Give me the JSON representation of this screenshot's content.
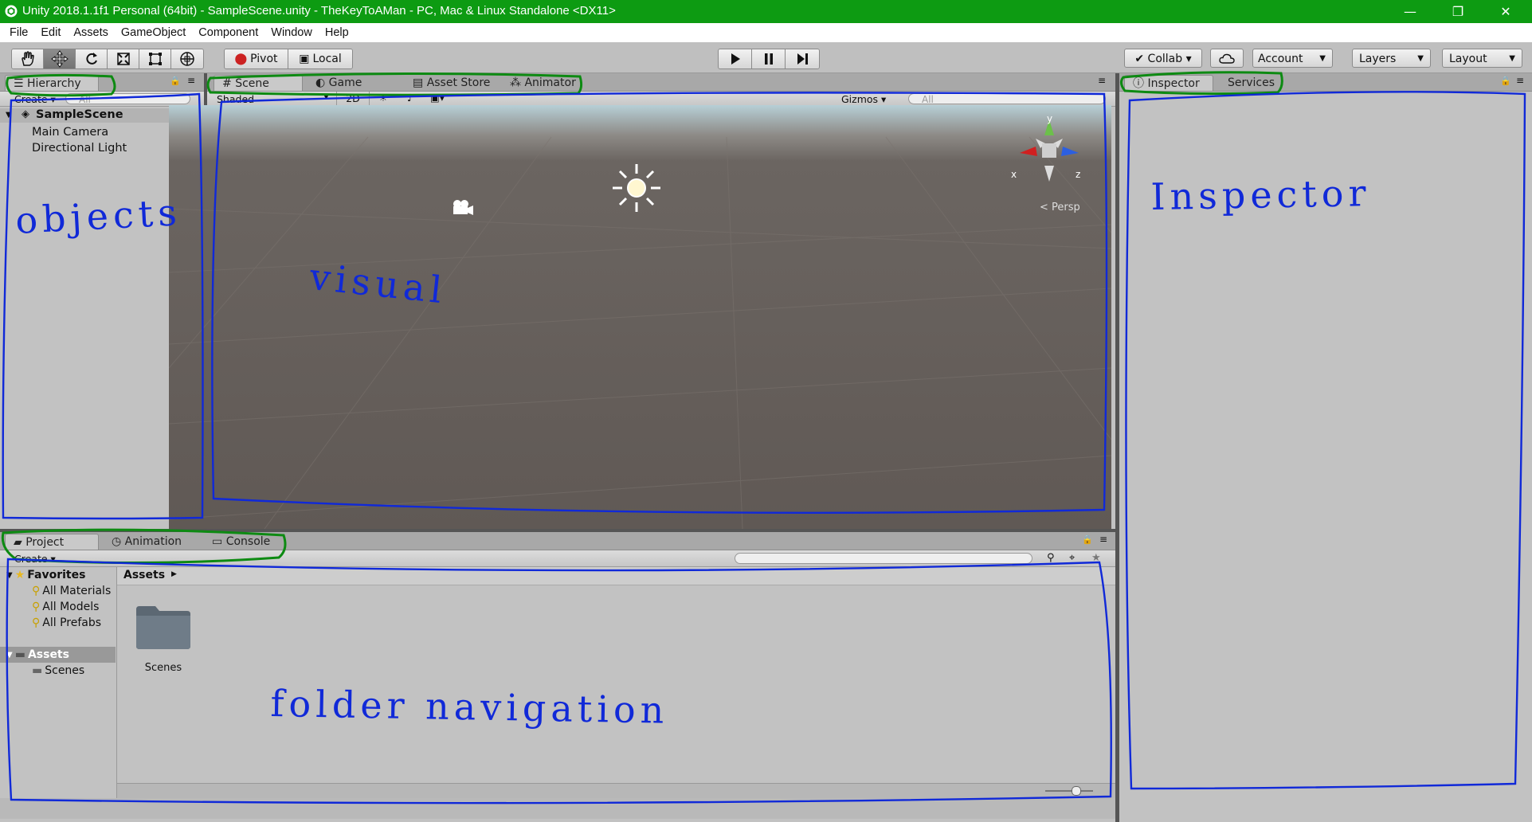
{
  "window": {
    "title": "Unity 2018.1.1f1 Personal (64bit) - SampleScene.unity - TheKeyToAMan - PC, Mac & Linux Standalone <DX11>",
    "controls": [
      "—",
      "❐",
      "✕"
    ]
  },
  "menu": [
    "File",
    "Edit",
    "Assets",
    "GameObject",
    "Component",
    "Window",
    "Help"
  ],
  "toolbar": {
    "pivot_label": "Pivot",
    "local_label": "Local",
    "collab_label": "Collab ▾",
    "account_label": "Account",
    "layers_label": "Layers",
    "layout_label": "Layout"
  },
  "hierarchy": {
    "tab_label": "Hierarchy",
    "create_label": "Create ▾",
    "search_placeholder": "All",
    "scene_name": "SampleScene",
    "objects": [
      "Main Camera",
      "Directional Light"
    ]
  },
  "scene_tabs": [
    "Scene",
    "Game",
    "Asset Store",
    "Animator"
  ],
  "scene_toolbar": {
    "shading": "Shaded",
    "mode_2d": "2D",
    "gizmos": "Gizmos ▾",
    "search_placeholder": "All"
  },
  "scene": {
    "gizmo_axes": {
      "y": "y",
      "x": "x",
      "z": "z"
    },
    "persp_label": "Persp"
  },
  "inspector_tabs": [
    "Inspector",
    "Services"
  ],
  "project": {
    "tabs": [
      "Project",
      "Animation",
      "Console"
    ],
    "create_label": "Create ▾",
    "favorites_label": "Favorites",
    "favorites": [
      "All Materials",
      "All Models",
      "All Prefabs"
    ],
    "assets_label": "Assets",
    "asset_folders": [
      "Scenes"
    ],
    "breadcrumb": "Assets",
    "grid_items": [
      "Scenes"
    ]
  },
  "annotations": {
    "objects": "objects",
    "visual": "visual",
    "inspector": "Inspector",
    "folder": "folder navigation"
  },
  "colors": {
    "title_bar": "#0d9b12",
    "panel_bg": "#c2c2c2",
    "annotation_blue": "#1029d8",
    "annotation_green": "#0d8a12"
  }
}
